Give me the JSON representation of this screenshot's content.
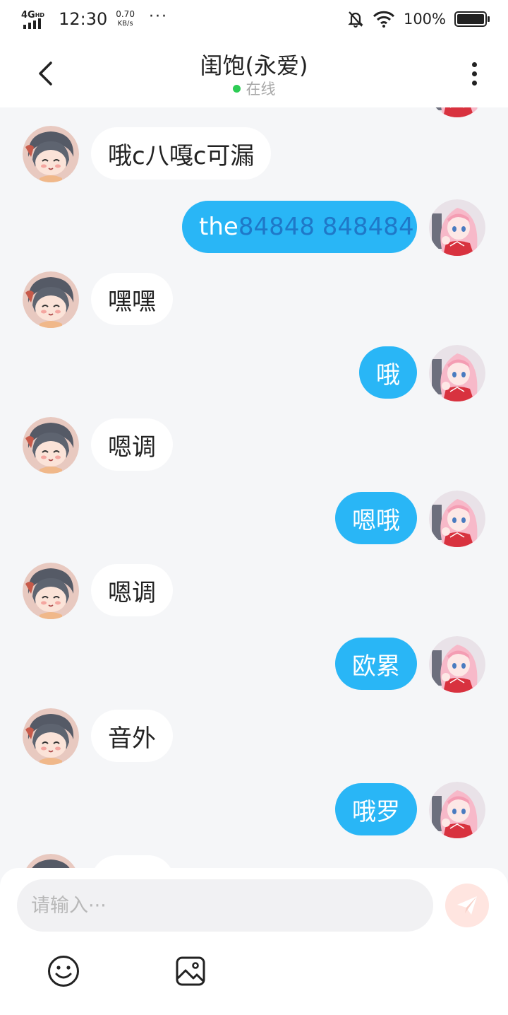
{
  "status_bar": {
    "network": "4G",
    "network_sup": "HD",
    "time": "12:30",
    "speed_value": "0.70",
    "speed_unit": "KB/s",
    "more": "···",
    "battery_pct": "100%"
  },
  "header": {
    "title": "闺饱(永爱)",
    "status": "在线",
    "status_color": "#2dcc55"
  },
  "messages": [
    {
      "side": "left",
      "text": "哦c八嘎c可漏"
    },
    {
      "side": "right",
      "text": "the",
      "text_highlight": "84848 848484"
    },
    {
      "side": "left",
      "text": "嘿嘿"
    },
    {
      "side": "right",
      "text": "哦"
    },
    {
      "side": "left",
      "text": "嗯调"
    },
    {
      "side": "right",
      "text": "嗯哦"
    },
    {
      "side": "left",
      "text": "嗯调"
    },
    {
      "side": "right",
      "text": "欧累"
    },
    {
      "side": "left",
      "text": "音外"
    },
    {
      "side": "right",
      "text": "哦罗"
    }
  ],
  "input": {
    "placeholder": "请输入···"
  },
  "colors": {
    "accent": "#29b6f6",
    "background": "#f5f6f8",
    "send_button": "#ffe5e0"
  },
  "icons": {
    "back": "chevron-left-icon",
    "menu": "more-vertical-icon",
    "send": "paper-plane-icon",
    "emoji": "smiley-icon",
    "image": "image-icon"
  }
}
